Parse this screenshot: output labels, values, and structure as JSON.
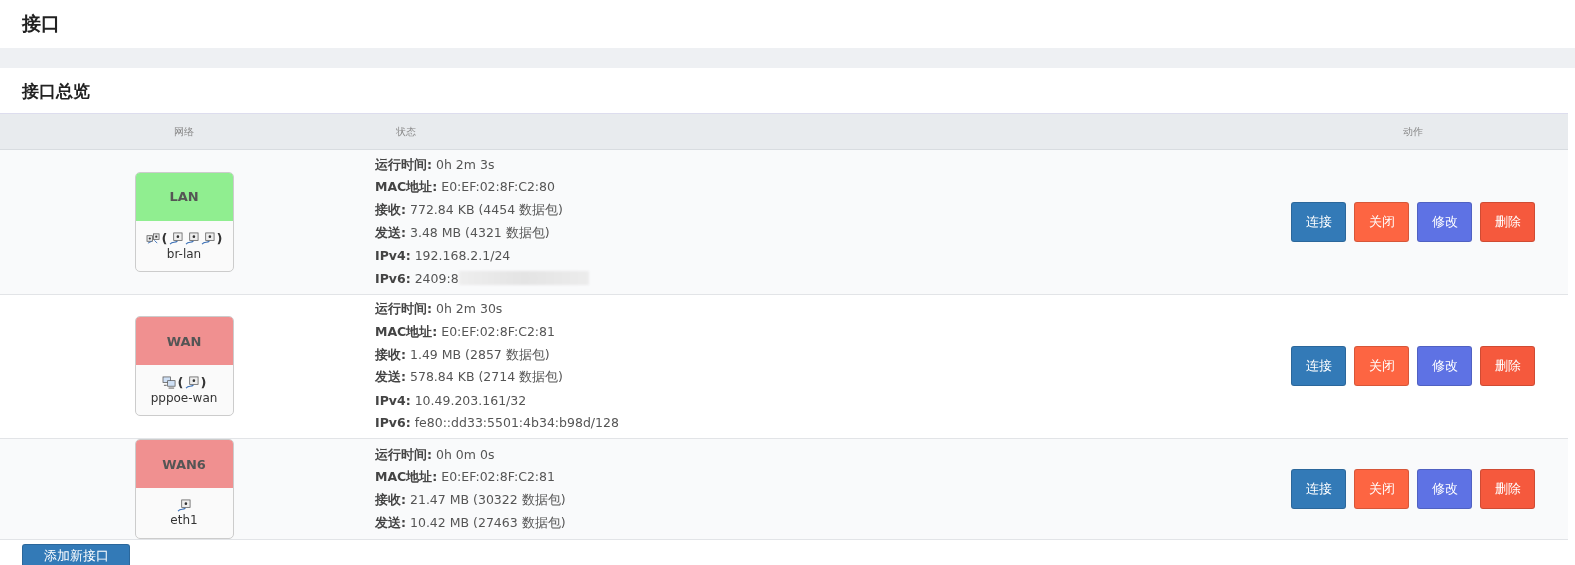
{
  "page_title": "接口",
  "section_title": "接口总览",
  "table": {
    "columns": [
      "网络",
      "状态",
      "动作"
    ],
    "rows": [
      {
        "name": "LAN",
        "color": "#90ee90",
        "device": "br-lan",
        "icons": [
          {
            "kind": "bridge"
          }
        ],
        "brackets": [
          "(",
          ")"
        ],
        "members": [
          {
            "kind": "ethernet"
          },
          {
            "kind": "ethernet"
          },
          {
            "kind": "ethernet"
          }
        ],
        "status": [
          {
            "label": "运行时间:",
            "value": "0h 2m 3s"
          },
          {
            "label": "MAC地址:",
            "value": "E0:EF:02:8F:C2:80"
          },
          {
            "label": "接收:",
            "value": "772.84 KB (4454 数据包)"
          },
          {
            "label": "发送:",
            "value": "3.48 MB (4321 数据包)"
          },
          {
            "label": "IPv4:",
            "value": "192.168.2.1/24"
          },
          {
            "label": "IPv6:",
            "value": "2409:8",
            "redacted": true
          }
        ],
        "actions": [
          "连接",
          "关闭",
          "修改",
          "删除"
        ]
      },
      {
        "name": "WAN",
        "color": "#f09090",
        "device": "pppoe-wan",
        "icons": [
          {
            "kind": "pppoe"
          }
        ],
        "brackets": [
          "(",
          ")"
        ],
        "members": [
          {
            "kind": "ethernet"
          }
        ],
        "status": [
          {
            "label": "运行时间:",
            "value": "0h 2m 30s"
          },
          {
            "label": "MAC地址:",
            "value": "E0:EF:02:8F:C2:81"
          },
          {
            "label": "接收:",
            "value": "1.49 MB (2857 数据包)"
          },
          {
            "label": "发送:",
            "value": "578.84 KB (2714 数据包)"
          },
          {
            "label": "IPv4:",
            "value": "10.49.203.161/32"
          },
          {
            "label": "IPv6:",
            "value": "fe80::dd33:5501:4b34:b98d/128",
            "redacted": false
          }
        ],
        "actions": [
          "连接",
          "关闭",
          "修改",
          "删除"
        ]
      },
      {
        "name": "WAN6",
        "color": "#f09090",
        "device": "eth1",
        "icons": [
          {
            "kind": "ethernet"
          }
        ],
        "members": [],
        "status": [
          {
            "label": "运行时间:",
            "value": "0h 0m 0s"
          },
          {
            "label": "MAC地址:",
            "value": "E0:EF:02:8F:C2:81"
          },
          {
            "label": "接收:",
            "value": "21.47 MB (30322 数据包)"
          },
          {
            "label": "发送:",
            "value": "10.42 MB (27463 数据包)"
          }
        ],
        "actions": [
          "连接",
          "关闭",
          "修改",
          "删除"
        ]
      }
    ]
  },
  "add_button": "添加新接口"
}
